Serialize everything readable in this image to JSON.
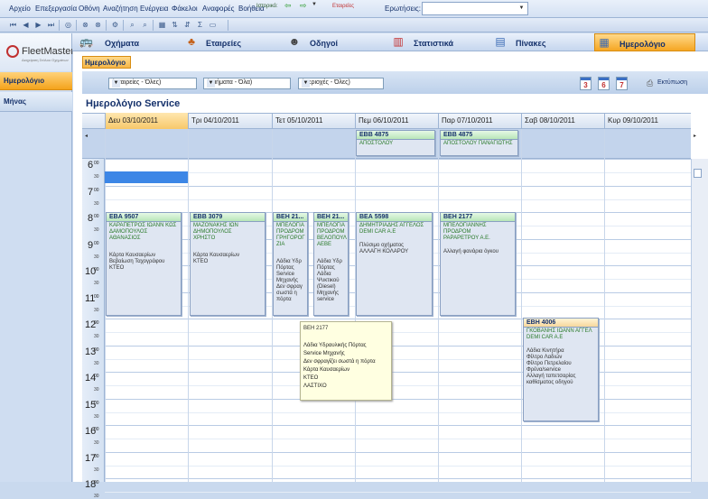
{
  "menubar": {
    "items": [
      "Αρχείο",
      "Επεξεργασία",
      "Οθόνη",
      "Αναζήτηση",
      "Ενέργεια",
      "Φάκελοι",
      "Αναφορές",
      "Βοήθεια"
    ],
    "question_label": "Ερωτήσεις:",
    "question_value": ""
  },
  "toolbar": {
    "history_label": "Ιστορικό:",
    "companies_label": "Εταιρείες",
    "buttons": [
      "first-icon",
      "prev-icon",
      "next-icon",
      "last-icon",
      "refresh-icon",
      "delete-icon",
      "settings-icon",
      "search-icon",
      "find-icon",
      "grid-icon",
      "sort-asc-icon",
      "sort-desc-icon",
      "sum-icon",
      "window-icon"
    ],
    "back_icon": "⇦",
    "forward_icon": "⇨"
  },
  "modules": {
    "tabs": [
      {
        "label": "Οχήματα",
        "icon": "vehicle-icon"
      },
      {
        "label": "Εταιρείες",
        "icon": "companies-icon"
      },
      {
        "label": "Οδηγοί",
        "icon": "driver-icon"
      },
      {
        "label": "Στατιστικά",
        "icon": "statistics-icon"
      },
      {
        "label": "Πίνακες",
        "icon": "tables-icon"
      },
      {
        "label": "Ημερολόγιο",
        "icon": "calendar-icon"
      }
    ],
    "active": "Ημερολόγιο"
  },
  "logo": {
    "text": "FleetMaster",
    "sub": "Διαχείριση Στόλου Οχημάτων"
  },
  "leftnav": {
    "items": [
      "Ημερολόγιο",
      "Μήνας"
    ]
  },
  "content": {
    "tab_label": "Ημερολόγιο",
    "filters": [
      "(Εταιρείες - Όλες)",
      "(Τμήματα - Όλα)",
      "(Περιοχές - Όλες)"
    ],
    "view_buttons": [
      "3",
      "6",
      "7"
    ],
    "print_label": "Εκτύπωση",
    "title": "Ημερολόγιο Service"
  },
  "days": [
    "Δευ 03/10/2011",
    "Τρι 04/10/2011",
    "Τετ 05/10/2011",
    "Πεμ 06/10/2011",
    "Παρ 07/10/2011",
    "Σαβ 08/10/2011",
    "Κυρ 09/10/2011"
  ],
  "hours": [
    "6",
    "7",
    "8",
    "9",
    "10",
    "11",
    "12",
    "13",
    "14",
    "15",
    "16",
    "17",
    "18"
  ],
  "hour_sup": "00",
  "half_label": "30",
  "allday": [
    {
      "plate": "ΕΒΒ 4875",
      "names": "ΑΠΟΣΤΟΛΟΥ"
    },
    {
      "plate": "ΕΒΒ 4875",
      "names": "ΑΠΟΣΤΟΛΟΥ ΠΑΝΑΓΙΩΤΗΣ"
    }
  ],
  "appointments": [
    {
      "plate": "ΕΒΑ 9507",
      "names": "ΚΑΡΑΠΕΤΡΟΣ ΙΩΑΝΝ ΚΩΣ\nΔΑΜΟΠΟΥΛΟΣ\nΑΘΑΝΑΣΙΟΣ",
      "tasks": "Κάρτα Καυσαερίων\nΒεβαίωση Ταχογράφου\nΚΤΕΟ"
    },
    {
      "plate": "ΕΒΒ 3079",
      "names": "ΜΑΖΟΝΑΚΗΣ ΙΩΝ\nΔΗΜΟΠΟΥΛΟΣ\nΧΡΗΣΤΟ",
      "tasks": "Κάρτα Καυσαερίων\nΚΤΕΟ"
    },
    {
      "plate": "ΒΕΗ 21...",
      "names": "ΜΠΕΛΟΓΙΑ\nΠΡΟΔΡΟΜ\nΓΡΗΓΟΡΟΓ\nΖΙΑ",
      "tasks": "Λάδια Υδρ\nΠόρτας\nService\nΜηχανής\nΔεν σφραγ\nσωστά η\nπόρτα"
    },
    {
      "plate": "ΒΕΗ 21...",
      "names": "ΜΠΕΛΟΓΙΑ\nΠΡΟΔΡΟΜ\nΒΕΛΟΠΟΥΛ\nΑΕΒΕ",
      "tasks": "Λάδια Υδρ\nΠόρτας\nΛάδια\nΨυκτικού\n(Diesel)\nΜηχανής\nservice"
    },
    {
      "plate": "ΒΕΑ 5598",
      "names": "ΔΗΜΗΤΡΙΑΔΗΣ ΑΓΓΕΛΟΣ\nDEMI CAR A.E",
      "tasks": "Πλύσιμο οχήματος\nΑΛΛΑΓΗ ΚΟΛΑΡΟΥ"
    },
    {
      "plate": "ΒΕΗ 2177",
      "names": "ΜΠΕΛΟΓΙΑΝΝΗΣ\nΠΡΟΔΡΟΜ\nΡΑΡΑΡΕΤΡΟΥ Α.Ε.",
      "tasks": "Αλλαγή φανάρια όγκου"
    },
    {
      "plate": "ΕΒΗ 4006",
      "names": "ΓΚΟΒΑΝΗΣ ΙΩΑΝΝ ΑΓΓΕΛ\nDEMI CAR A.E",
      "tasks": "Λάδια Κινητήρα\nΦίλτρο Λαδιών\nΦίλτρο Πετρελαίου\nΦρένα/service\nΑλλαγή ταπετσαρίας\nκαθίσματος οδηγού"
    }
  ],
  "tooltip": {
    "plate": "ΒΕΗ 2177",
    "text": "Λάδια Υδραυλικής Πόρτας\nService Μηχανής\nΔεν σφραγίζει σωστά η πόρτα\nΚάρτα Καυσαερίων\nΚΤΕΟ\nΛΑΣΤΙΧΟ"
  }
}
